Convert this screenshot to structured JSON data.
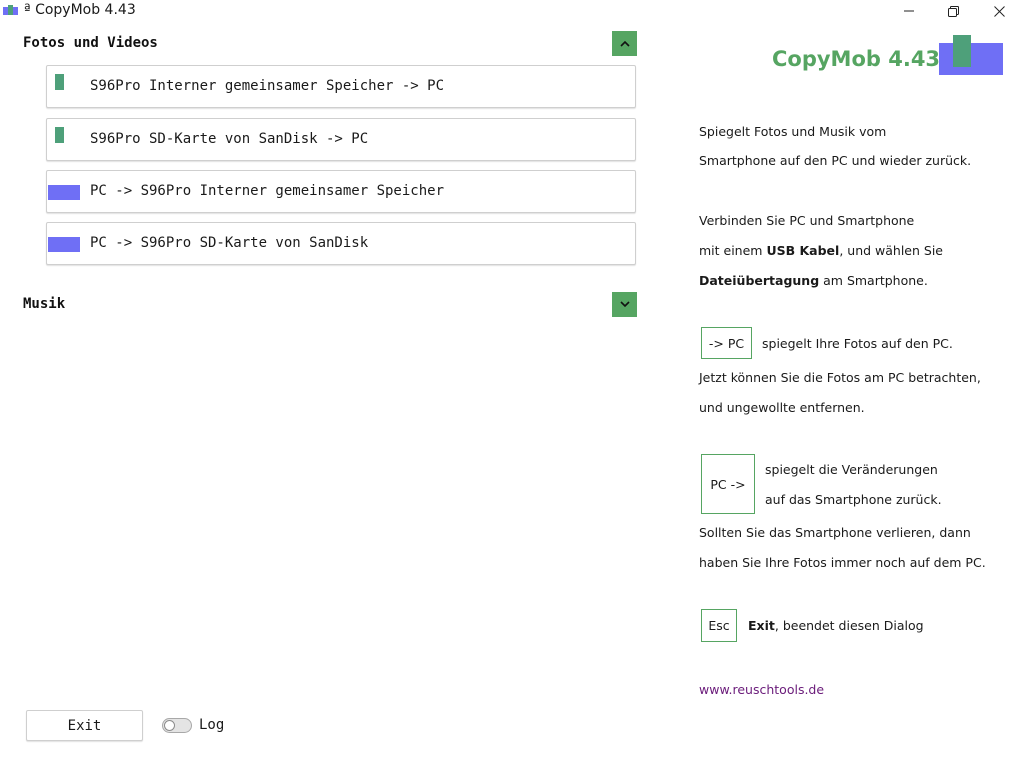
{
  "window": {
    "title_prefix": "ª",
    "title": "CopyMob 4.43",
    "controls": [
      "minimize",
      "maximize",
      "close"
    ]
  },
  "sections": [
    {
      "title": "Fotos und Videos",
      "expanded": true,
      "items": [
        {
          "label": "S96Pro Interner gemeinsamer Speicher -> PC",
          "marker_color": "#4ea07a"
        },
        {
          "label": "S96Pro SD-Karte von SanDisk -> PC",
          "marker_color": "#4ea07a"
        },
        {
          "label": "PC -> S96Pro Interner gemeinsamer Speicher",
          "marker_color": "#6f6ff5"
        },
        {
          "label": "PC -> S96Pro SD-Karte von SanDisk",
          "marker_color": "#6f6ff5"
        }
      ]
    },
    {
      "title": "Musik",
      "expanded": false,
      "items": []
    }
  ],
  "info_panel": {
    "brand": "CopyMob 4.43",
    "p1": [
      "Spiegelt Fotos und Musik vom",
      "Smartphone auf den PC und wieder zurück."
    ],
    "p2_line1": "Verbinden Sie PC und Smartphone",
    "p2_line2_a": "mit einem ",
    "p2_line2_b": "USB Kabel",
    "p2_line2_c": ", und wählen Sie",
    "p2_line3_a": "Dateiübertagung",
    "p2_line3_b": " am Smartphone.",
    "key_to_pc": "-> PC",
    "key_to_pc_text": "spiegelt Ihre Fotos auf den PC.",
    "p3": [
      "Jetzt können Sie die Fotos am PC betrachten,",
      "und ungewollte entfernen."
    ],
    "key_from_pc": "PC ->",
    "key_from_pc_text": [
      "spiegelt die Veränderungen",
      "auf das Smartphone zurück."
    ],
    "p4": [
      "Sollten Sie das Smartphone verlieren, dann",
      "haben Sie Ihre Fotos immer noch auf dem PC."
    ],
    "key_esc": "Esc",
    "esc_bold": "Exit",
    "esc_text": ", beendet diesen Dialog",
    "link": "www.reuschtools.de"
  },
  "footer": {
    "exit_label": "Exit",
    "log_label": "Log",
    "log_enabled": false
  },
  "colors": {
    "accent_green": "#56a562",
    "marker_green": "#4ea07a",
    "marker_blue": "#6f6ff5",
    "link_purple": "#6a1b7a"
  }
}
